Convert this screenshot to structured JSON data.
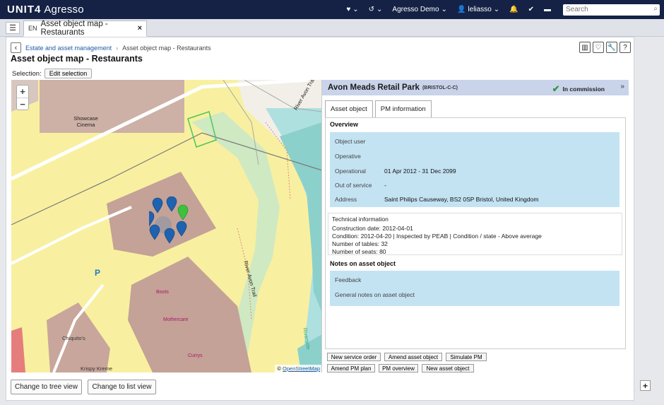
{
  "brand": {
    "logo": "UNIT4",
    "product": "Agresso"
  },
  "topnav": {
    "company": "Agresso Demo",
    "user": "leliasso",
    "search_placeholder": "Search"
  },
  "tab": {
    "lang": "EN",
    "label": "Asset object map - Restaurants"
  },
  "breadcrumb": {
    "parent": "Estate and asset management",
    "current": "Asset object map - Restaurants"
  },
  "page_title": "Asset object map - Restaurants",
  "selection": {
    "label": "Selection:",
    "button": "Edit selection"
  },
  "map": {
    "labels": {
      "cinema": "Showcase Cinema",
      "trail_1": "River Avon Trail",
      "trail_2": "River Avon Trail",
      "boots": "Boots",
      "mothercare": "Mothercare",
      "currys": "Currys",
      "chiquitos": "Chiquito's",
      "krispy": "Krispy Kreme",
      "parking": "P",
      "waterside": "Riverside"
    },
    "attribution_prefix": "©",
    "attribution_link": "OpenStreetMap"
  },
  "panel": {
    "title": "Avon Meads Retail Park",
    "code": "(BRISTOL-C-C)",
    "status": "In commission",
    "tabs": [
      "Asset object",
      "PM information"
    ],
    "overview_title": "Overview",
    "overview": [
      {
        "key": "Object user",
        "value": ""
      },
      {
        "key": "Operative",
        "value": ""
      },
      {
        "key": "Operational",
        "value": "01 Apr 2012 - 31 Dec 2099"
      },
      {
        "key": "Out of service",
        "value": "-"
      },
      {
        "key": "Address",
        "value": "Saint Philips Causeway, BS2 0SP Bristol, United Kingdom"
      }
    ],
    "tech_title": "Technical information",
    "tech_lines": [
      "Construction date: 2012-04-01",
      "Condition: 2012-04-20 | Inspected by PEAB | Condition / state - Above average",
      "Number of tables: 32",
      "Number of seats: 80"
    ],
    "notes_title": "Notes on asset object",
    "notes": [
      "Feedback",
      "General notes on asset object"
    ],
    "actions": [
      "New service order",
      "Amend asset object",
      "Simulate PM",
      "Amend PM plan",
      "PM overview",
      "New asset object"
    ]
  },
  "bottom": {
    "tree": "Change to tree view",
    "list": "Change to list view"
  },
  "colors": {
    "topbar": "#152246",
    "overview_bg": "#c3e3f3",
    "panel_header": "#c9d3ea",
    "marker_blue": "#1f62b0",
    "marker_green": "#3cc13c"
  },
  "icons": [
    "heart-icon",
    "history-icon",
    "user-icon",
    "bell-icon",
    "check-icon",
    "chat-icon",
    "search-icon",
    "menu-icon",
    "back-icon",
    "layout-icon",
    "favorite-icon",
    "wrench-icon",
    "help-icon",
    "plus-icon"
  ]
}
